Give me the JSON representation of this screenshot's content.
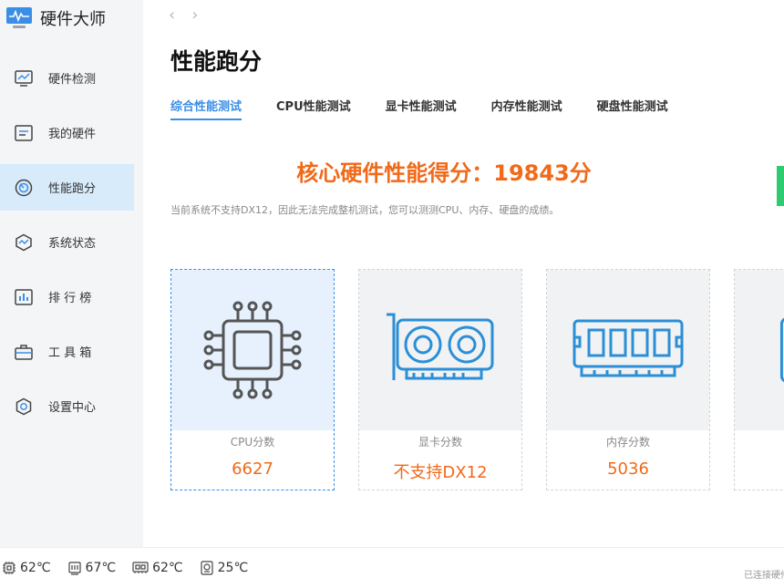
{
  "app": {
    "title": "硬件大师"
  },
  "sidebar": {
    "items": [
      {
        "label": "硬件检测",
        "icon": "monitor-chart-icon"
      },
      {
        "label": "我的硬件",
        "icon": "hardware-list-icon"
      },
      {
        "label": "性能跑分",
        "icon": "speedometer-icon",
        "active": true
      },
      {
        "label": "系统状态",
        "icon": "system-status-icon"
      },
      {
        "label": "排 行 榜",
        "icon": "ranking-icon"
      },
      {
        "label": "工 具 箱",
        "icon": "toolbox-icon"
      },
      {
        "label": "设置中心",
        "icon": "settings-icon"
      }
    ]
  },
  "main": {
    "title": "性能跑分",
    "tabs": [
      {
        "label": "综合性能测试",
        "active": true
      },
      {
        "label": "CPU性能测试"
      },
      {
        "label": "显卡性能测试"
      },
      {
        "label": "内存性能测试"
      },
      {
        "label": "硬盘性能测试"
      }
    ],
    "score_text": "核心硬件性能得分：19843分",
    "notice": "当前系统不支持DX12，因此无法完成整机测试，您可以测测CPU、内存、硬盘的成绩。",
    "cards": [
      {
        "caption": "CPU分数",
        "value": "6627",
        "icon": "cpu-chip-icon"
      },
      {
        "caption": "显卡分数",
        "value": "不支持DX12",
        "icon": "graphics-card-icon"
      },
      {
        "caption": "内存分数",
        "value": "5036",
        "icon": "memory-module-icon"
      }
    ]
  },
  "statusbar": {
    "items": [
      {
        "value": "62℃",
        "icon": "cpu-temp-icon"
      },
      {
        "value": "67℃",
        "icon": "gpu-temp-icon"
      },
      {
        "value": "62℃",
        "icon": "board-temp-icon"
      },
      {
        "value": "25℃",
        "icon": "disk-temp-icon"
      }
    ],
    "right_text": "已连接硬件"
  },
  "colors": {
    "accent": "#3a8ee6",
    "score": "#f06a1a",
    "active_nav": "#d8ebfb"
  }
}
